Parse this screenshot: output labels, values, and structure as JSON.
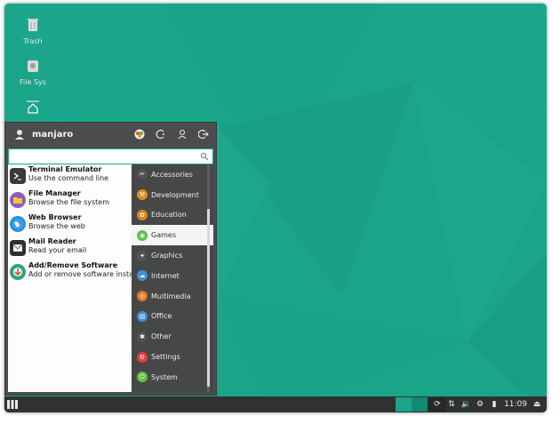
{
  "desktop": {
    "icons": [
      {
        "label": "Trash",
        "icon": "trash-icon"
      },
      {
        "label": "File Sys",
        "icon": "drive-icon"
      },
      {
        "label": "",
        "icon": "home-icon"
      }
    ]
  },
  "menu": {
    "username": "manjaro",
    "search": {
      "value": "",
      "placeholder": ""
    },
    "favorites": [
      {
        "title": "Terminal Emulator",
        "subtitle": "Use the command line",
        "icon": "terminal-icon",
        "color": "#3a3a3a"
      },
      {
        "title": "File Manager",
        "subtitle": "Browse the file system",
        "icon": "folder-icon",
        "color": "#8b5fb8"
      },
      {
        "title": "Web Browser",
        "subtitle": "Browse the web",
        "icon": "globe-icon",
        "color": "#2d8fd6"
      },
      {
        "title": "Mail Reader",
        "subtitle": "Read your email",
        "icon": "mail-icon",
        "color": "#2f2f2f"
      },
      {
        "title": "Add/Remove Software",
        "subtitle": "Add or remove software insta...",
        "icon": "package-icon",
        "color": "#2aa57f"
      }
    ],
    "categories": [
      {
        "label": "Accessories",
        "icon": "accessories-icon",
        "color": "#505352"
      },
      {
        "label": "Development",
        "icon": "development-icon",
        "color": "#e08a1c"
      },
      {
        "label": "Education",
        "icon": "education-icon",
        "color": "#e0801c"
      },
      {
        "label": "Games",
        "icon": "games-icon",
        "color": "#5bbf4a",
        "active": true
      },
      {
        "label": "Graphics",
        "icon": "graphics-icon",
        "color": "#505352"
      },
      {
        "label": "Internet",
        "icon": "internet-icon",
        "color": "#3d8fd8"
      },
      {
        "label": "Multimedia",
        "icon": "multimedia-icon",
        "color": "#e0781c"
      },
      {
        "label": "Office",
        "icon": "office-icon",
        "color": "#3d8fd8"
      },
      {
        "label": "Other",
        "icon": "other-icon",
        "color": "#505352"
      },
      {
        "label": "Settings",
        "icon": "settings-icon",
        "color": "#e23d3d"
      },
      {
        "label": "System",
        "icon": "system-icon",
        "color": "#6cbf3a"
      }
    ]
  },
  "panel": {
    "clock": "11:09",
    "accent": "#1aa589"
  }
}
